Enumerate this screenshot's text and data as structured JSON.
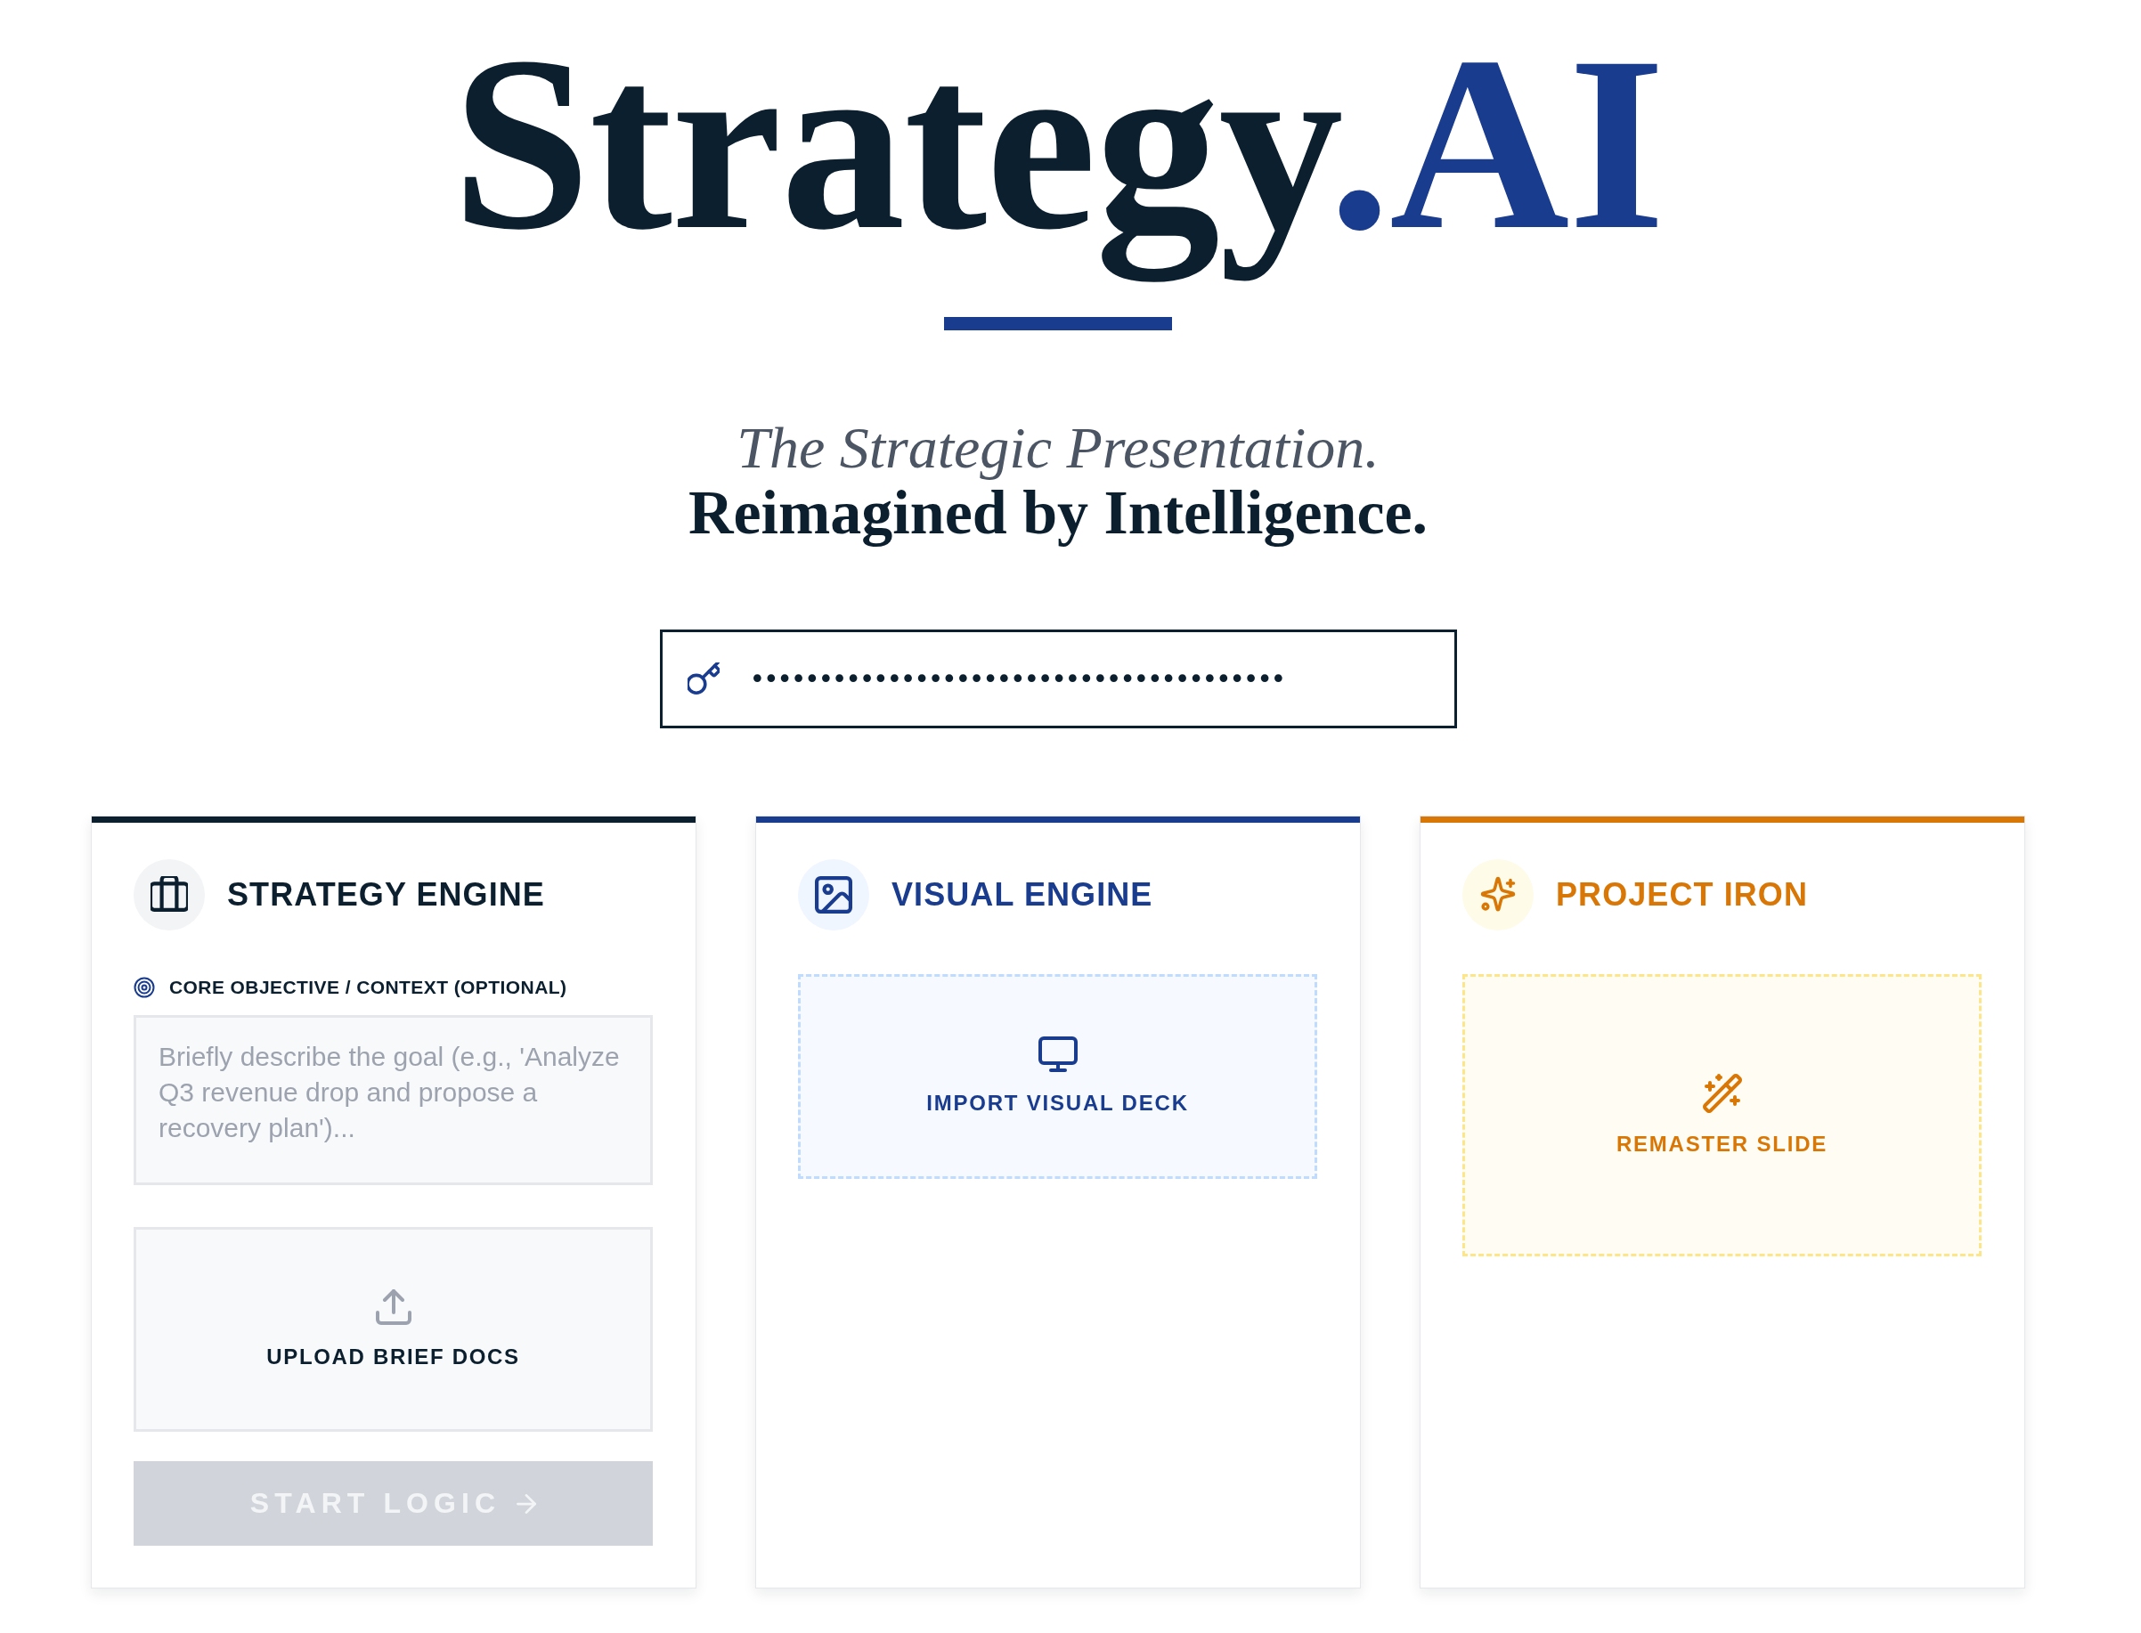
{
  "logo": {
    "wordmark": "Strategy",
    "accent": ".AI"
  },
  "tagline": {
    "line_1": "The Strategic Presentation.",
    "line_2": "Reimagined by Intelligence."
  },
  "api_key_field": {
    "value": "•••••••••••••••••••••••••••••••••••••••"
  },
  "cards": [
    {
      "kind": "strategy",
      "title": "STRATEGY ENGINE",
      "color": "#0b1f2e",
      "objective": {
        "label": "CORE OBJECTIVE / CONTEXT (OPTIONAL)",
        "placeholder": "Briefly describe the goal (e.g., 'Analyze Q3 revenue drop and propose a recovery plan')..."
      },
      "upload": {
        "label": "UPLOAD BRIEF DOCS"
      },
      "submit": {
        "label": "START LOGIC",
        "disabled": true
      }
    },
    {
      "kind": "visual",
      "title": "VISUAL ENGINE",
      "color": "#1a3c8e",
      "dropzone": {
        "label": "IMPORT VISUAL DECK"
      }
    },
    {
      "kind": "remaster",
      "title": "PROJECT IRON",
      "color": "#d97706",
      "dropzone": {
        "label": "REMASTER SLIDE"
      }
    }
  ]
}
